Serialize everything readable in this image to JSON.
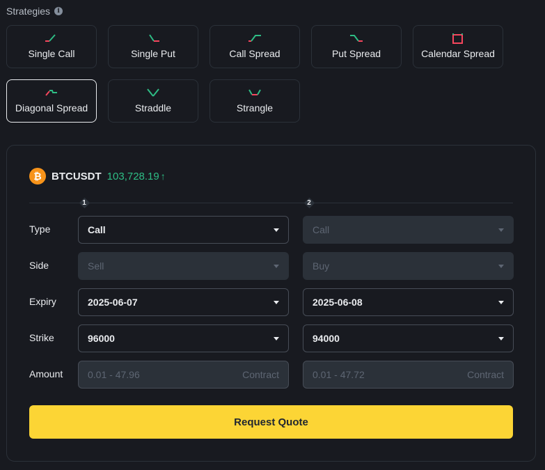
{
  "header": {
    "title": "Strategies",
    "info_icon": "info-icon"
  },
  "strategies": [
    {
      "label": "Single Call",
      "icon": "single-call-icon"
    },
    {
      "label": "Single Put",
      "icon": "single-put-icon"
    },
    {
      "label": "Call Spread",
      "icon": "call-spread-icon"
    },
    {
      "label": "Put Spread",
      "icon": "put-spread-icon"
    },
    {
      "label": "Calendar Spread",
      "icon": "calendar-spread-icon"
    },
    {
      "label": "Diagonal Spread",
      "icon": "diagonal-spread-icon",
      "selected": true
    },
    {
      "label": "Straddle",
      "icon": "straddle-icon"
    },
    {
      "label": "Strangle",
      "icon": "strangle-icon"
    }
  ],
  "ticker": {
    "logo": "₿",
    "symbol": "BTCUSDT",
    "price": "103,728.19",
    "direction_icon": "arrow-up-icon"
  },
  "legs": {
    "leg1": "1",
    "leg2": "2"
  },
  "labels": {
    "type": "Type",
    "side": "Side",
    "expiry": "Expiry",
    "strike": "Strike",
    "amount": "Amount"
  },
  "leg1": {
    "type": "Call",
    "side": "Sell",
    "expiry": "2025-06-07",
    "strike": "96000",
    "amount_placeholder": "0.01 - 47.96",
    "amount_unit": "Contract"
  },
  "leg2": {
    "type": "Call",
    "side": "Buy",
    "expiry": "2025-06-08",
    "strike": "94000",
    "amount_placeholder": "0.01 - 47.72",
    "amount_unit": "Contract"
  },
  "button": {
    "request_quote": "Request Quote"
  },
  "colors": {
    "accent": "#fcd535",
    "up": "#2ebd85",
    "down": "#f6465d",
    "bitcoin": "#f7931a"
  }
}
